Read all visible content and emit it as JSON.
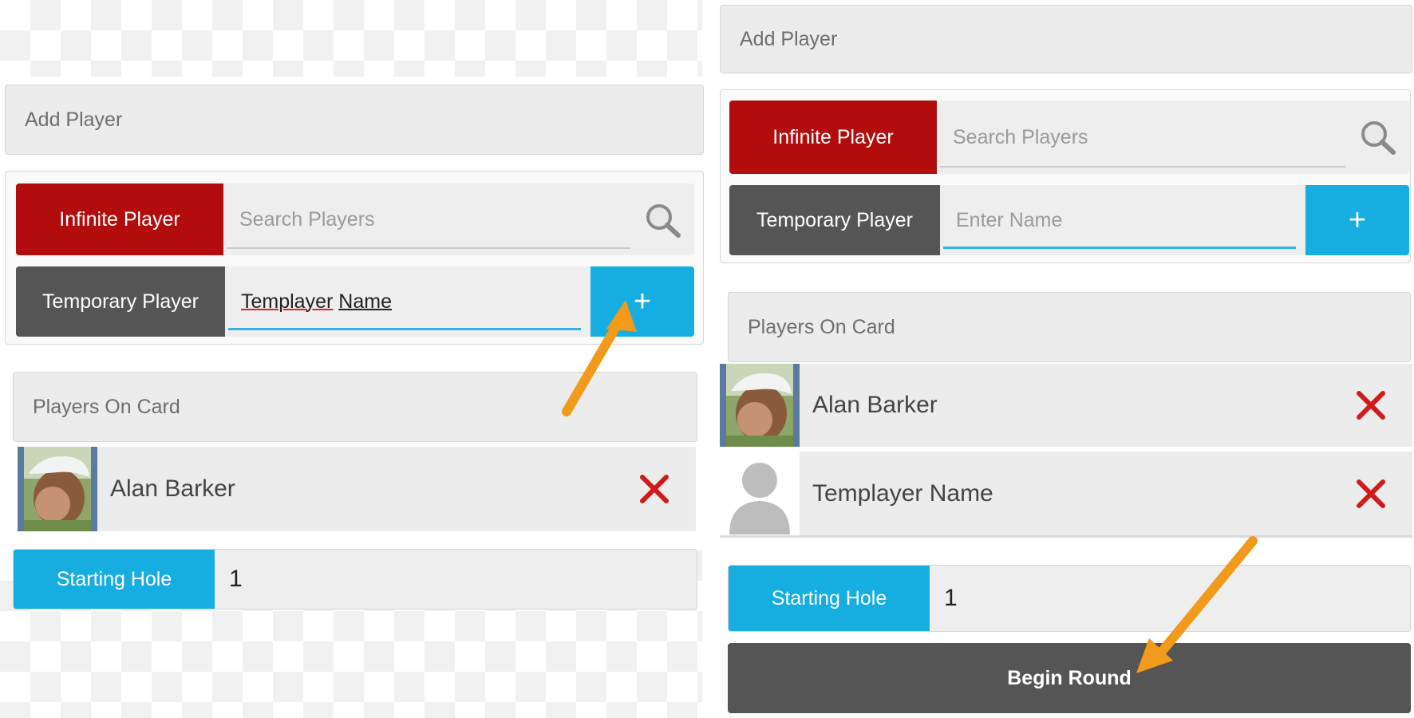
{
  "left": {
    "add_player": "Add Player",
    "infinite_player": "Infinite Player",
    "search_placeholder": "Search Players",
    "temporary_player": "Temporary Player",
    "temp_value_word1": "Templayer",
    "temp_value_word2": "Name",
    "add_symbol": "+",
    "players_on_card": "Players On Card",
    "players": [
      {
        "name": "Alan Barker"
      }
    ],
    "starting_hole_label": "Starting Hole",
    "starting_hole_value": "1"
  },
  "right": {
    "add_player": "Add Player",
    "infinite_player": "Infinite Player",
    "search_placeholder": "Search Players",
    "temporary_player": "Temporary Player",
    "temp_placeholder": "Enter Name",
    "add_symbol": "+",
    "players_on_card": "Players On Card",
    "players": [
      {
        "name": "Alan Barker"
      },
      {
        "name": "Templayer Name"
      }
    ],
    "starting_hole_label": "Starting Hole",
    "starting_hole_value": "1",
    "begin_round": "Begin Round"
  },
  "colors": {
    "infinite_red": "#b30c0c",
    "temporary_dark": "#555555",
    "accent_blue": "#16aee0",
    "remove_red": "#d11b1b",
    "annotation_arrow": "#f29a1b"
  },
  "icons": [
    "search-icon",
    "plus-icon",
    "remove-x-icon",
    "avatar-photo",
    "default-avatar-icon",
    "annotation-arrow"
  ]
}
